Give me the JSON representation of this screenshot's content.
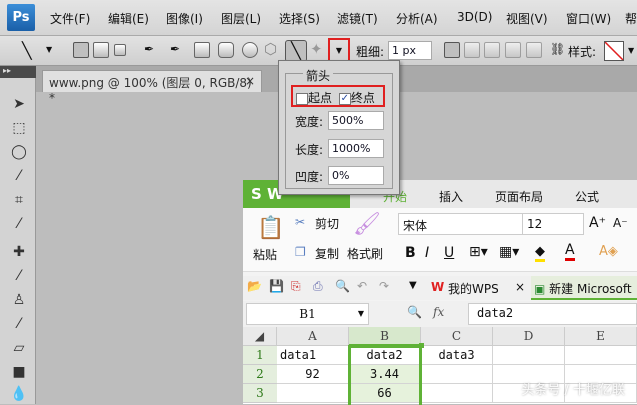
{
  "photoshop": {
    "logo": "Ps",
    "menu": [
      "文件(F)",
      "编辑(E)",
      "图像(I)",
      "图层(L)",
      "选择(S)",
      "滤镜(T)",
      "分析(A)",
      "3D(D)",
      "视图(V)",
      "窗口(W)",
      "帮"
    ],
    "options": {
      "weight_label": "粗细:",
      "weight_value": "1 px",
      "style_label": "样式:"
    },
    "doc_tab": "www.png @ 100% (图层 0, RGB/8) *",
    "doc_tab_close": "×",
    "arrow_popup": {
      "title": "箭头",
      "start_label": "起点",
      "start_checked": false,
      "end_label": "终点",
      "end_checked": true,
      "width_label": "宽度:",
      "width_value": "500%",
      "length_label": "长度:",
      "length_value": "1000%",
      "concavity_label": "凹度:",
      "concavity_value": "0%"
    }
  },
  "wps": {
    "logo": "S W",
    "tabs": [
      "开始",
      "插入",
      "页面布局",
      "公式"
    ],
    "ribbon": {
      "paste": "粘贴",
      "cut": "剪切",
      "copy": "复制",
      "format_painter": "格式刷",
      "font": "宋体",
      "size": "12",
      "bold": "B",
      "italic": "I",
      "underline": "U"
    },
    "doc_tabs": [
      {
        "label": "我的WPS",
        "close": "×"
      },
      {
        "label": "新建 Microsoft"
      }
    ],
    "name_box": "B1",
    "fx": "fx",
    "formula": "data2",
    "columns": [
      "A",
      "B",
      "C",
      "D",
      "E"
    ],
    "rows": [
      [
        "1",
        "data1",
        "data2",
        "data3",
        "",
        ""
      ],
      [
        "2",
        "92",
        "3.44",
        "",
        "",
        ""
      ],
      [
        "3",
        "",
        "66",
        "",
        "",
        ""
      ]
    ]
  },
  "watermark": "头条号 / 十堰亿联"
}
